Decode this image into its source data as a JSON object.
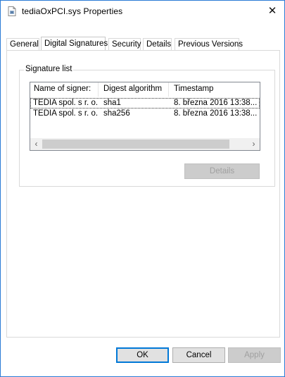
{
  "window": {
    "title": "tediaOxPCI.sys Properties",
    "close_glyph": "✕"
  },
  "tabs": [
    {
      "label": "General"
    },
    {
      "label": "Digital Signatures",
      "active": true
    },
    {
      "label": "Security"
    },
    {
      "label": "Details"
    },
    {
      "label": "Previous Versions"
    }
  ],
  "signature_list": {
    "group_label": "Signature list",
    "columns": [
      "Name of signer:",
      "Digest algorithm",
      "Timestamp"
    ],
    "rows": [
      {
        "signer": "TEDIA spol. s r. o.",
        "algorithm": "sha1",
        "timestamp": "8. března 2016 13:38..."
      },
      {
        "signer": "TEDIA spol. s r. o.",
        "algorithm": "sha256",
        "timestamp": "8. března 2016 13:38..."
      }
    ],
    "details_button": "Details"
  },
  "footer": {
    "ok": "OK",
    "cancel": "Cancel",
    "apply": "Apply"
  },
  "colors": {
    "window_border": "#2b7bd6",
    "default_button_border": "#0078d7"
  },
  "icons": {
    "title": "file-icon",
    "scroll_left": "chevron-left-icon",
    "scroll_right": "chevron-right-icon"
  }
}
